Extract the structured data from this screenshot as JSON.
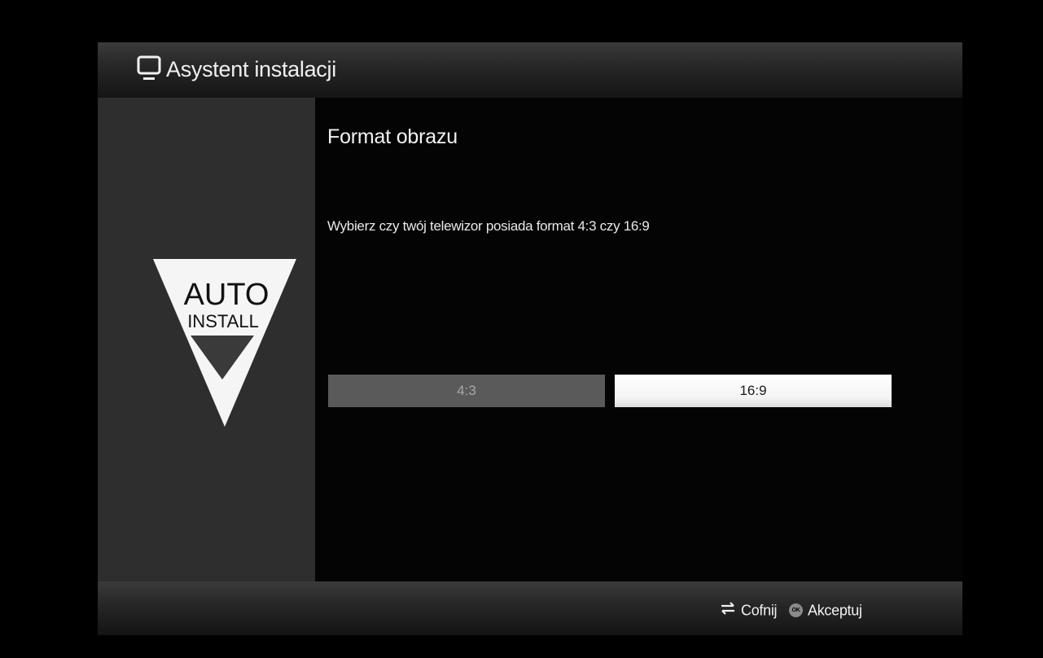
{
  "header": {
    "title": "Asystent instalacji",
    "icon": "tv-monitor-icon"
  },
  "sidebar": {
    "logo_line1": "AUTO",
    "logo_line2": "INSTALL",
    "logo_icon": "auto-install-triangle-icon"
  },
  "main": {
    "section_title": "Format obrazu",
    "instruction": "Wybierz czy twój telewizor posiada format 4:3 czy 16:9",
    "options": [
      {
        "label": "4:3",
        "selected": false
      },
      {
        "label": "16:9",
        "selected": true
      }
    ]
  },
  "footer": {
    "back_icon": "swap-arrows-icon",
    "back_label": "Cofnij",
    "ok_icon": "ok-button-icon",
    "ok_icon_text": "OK",
    "ok_label": "Akceptuj"
  },
  "colors": {
    "background": "#000000",
    "sidebar": "#2e2e2e",
    "option_unselected": "#5a5a5a",
    "option_selected": "#ffffff"
  }
}
